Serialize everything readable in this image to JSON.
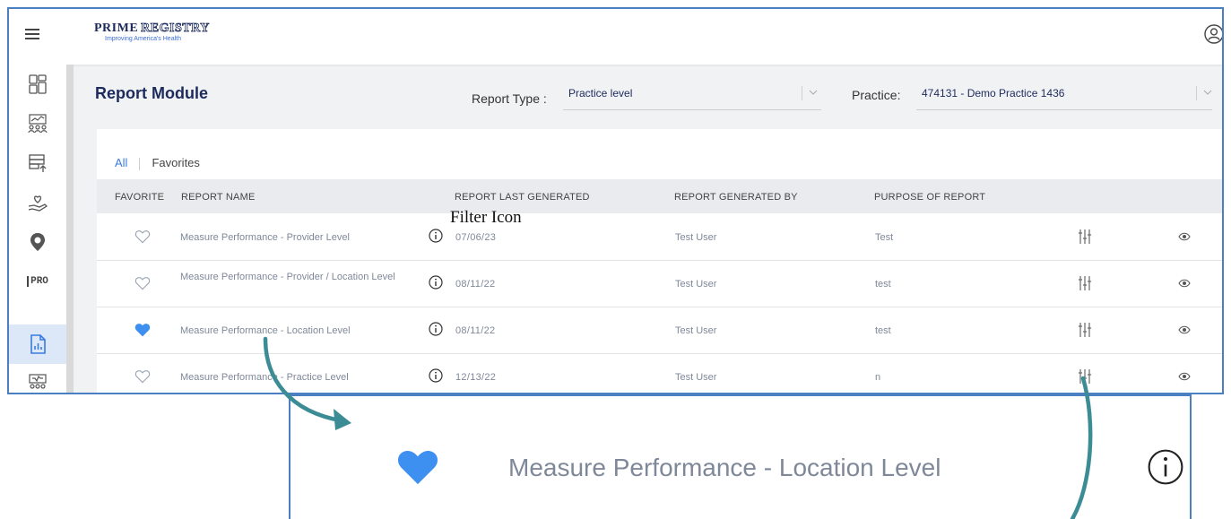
{
  "app": {
    "brand_name": "PRIME",
    "brand_registry": "REGISTRY",
    "brand_tagline": "Improving America's Health"
  },
  "page": {
    "title": "Report Module",
    "report_type_label": "Report Type :",
    "report_type_value": "Practice level",
    "practice_label": "Practice:",
    "practice_value": "474131 - Demo Practice 1436"
  },
  "tabs": {
    "all": "All",
    "favorites": "Favorites"
  },
  "table": {
    "columns": {
      "favorite": "FAVORITE",
      "report_name": "REPORT NAME",
      "last_generated": "REPORT LAST GENERATED",
      "generated_by": "REPORT GENERATED BY",
      "purpose": "PURPOSE OF REPORT"
    },
    "rows": [
      {
        "favorite": false,
        "name": "Measure Performance - Provider Level",
        "date": "07/06/23",
        "generated_by": "Test User",
        "purpose": "Test"
      },
      {
        "favorite": false,
        "name": "Measure Performance - Provider / Location Level",
        "date": "08/11/22",
        "generated_by": "Test User",
        "purpose": "test"
      },
      {
        "favorite": true,
        "name": "Measure Performance - Location Level",
        "date": "08/11/22",
        "generated_by": "Test User",
        "purpose": "test"
      },
      {
        "favorite": false,
        "name": "Measure Performance - Practice Level",
        "date": "12/13/22",
        "generated_by": "Test User",
        "purpose": "n"
      }
    ]
  },
  "annotation": {
    "label": "Filter Icon"
  },
  "zoom": {
    "label": "Measure Performance - Location Level"
  },
  "sidebar": {
    "pro_label": "PRO"
  },
  "colors": {
    "accent": "#3a7be0",
    "heart_filled": "#3d8ff0",
    "arrow": "#3b8c95",
    "frame_border": "#4a7fc1"
  }
}
